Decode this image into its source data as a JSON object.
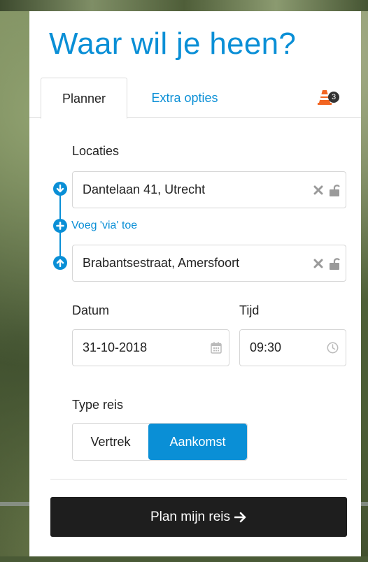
{
  "page": {
    "title": "Waar wil je heen?"
  },
  "tabs": {
    "planner": "Planner",
    "extra": "Extra opties",
    "alert_count": "3"
  },
  "locations": {
    "label": "Locaties",
    "from": "Dantelaan 41, Utrecht",
    "via": "Voeg 'via' toe",
    "to": "Brabantsestraat, Amersfoort"
  },
  "datetime": {
    "date_label": "Datum",
    "date_value": "31-10-2018",
    "time_label": "Tijd",
    "time_value": "09:30"
  },
  "trip_type": {
    "label": "Type reis",
    "options": [
      "Vertrek",
      "Aankomst"
    ],
    "selected": "Aankomst"
  },
  "submit": {
    "label": "Plan mijn reis"
  },
  "colors": {
    "accent": "#0a8fd6",
    "submit_bg": "#1e1e1e",
    "alert_orange": "#f26522"
  },
  "icons": {
    "from": "arrow-down-circle-icon",
    "via": "plus-circle-icon",
    "to": "arrow-up-circle-icon",
    "clear": "close-x-icon",
    "lock": "unlock-icon",
    "date": "calendar-icon",
    "time": "clock-icon",
    "alert": "traffic-cone-icon",
    "submit": "arrow-right-icon"
  }
}
